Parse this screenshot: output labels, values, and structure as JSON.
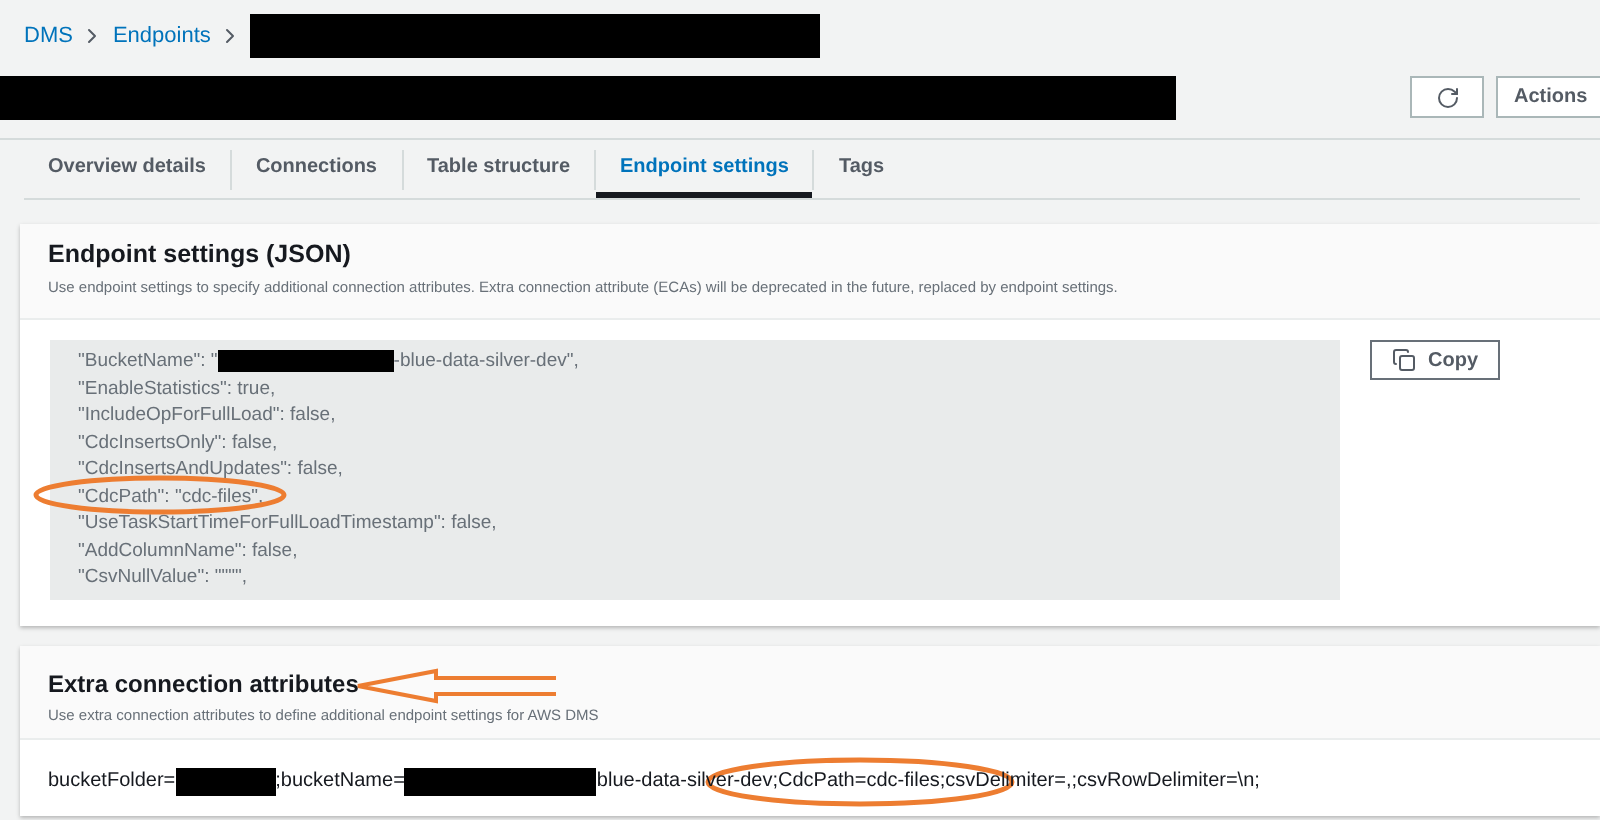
{
  "breadcrumb": [
    {
      "text": "DMS",
      "kind": "link"
    },
    {
      "text": "Endpoints",
      "kind": "link"
    },
    {
      "kind": "redaction"
    }
  ],
  "header": {
    "title": {
      "kind": "redaction"
    },
    "actions": [
      {
        "kind": "refresh"
      },
      {
        "kind": "menu",
        "label": "Actions"
      }
    ]
  },
  "tabs": [
    {
      "label": "Overview details",
      "selected": false
    },
    {
      "label": "Connections",
      "selected": false
    },
    {
      "label": "Table structure",
      "selected": false
    },
    {
      "label": "Endpoint settings",
      "selected": true
    },
    {
      "label": "Tags",
      "selected": false
    }
  ],
  "endpoint_settings": {
    "title": "Endpoint settings (JSON)",
    "description": "Use endpoint settings to specify additional connection attributes. Extra connection attribute (ECAs) will be deprecated in the future, replaced by endpoint settings.",
    "lines": [
      [
        {
          "kind": "text",
          "text": "\"BucketName\": \""
        },
        {
          "kind": "redaction"
        },
        {
          "kind": "text",
          "text": "-blue-data-silver-dev\","
        }
      ],
      [
        {
          "kind": "text",
          "text": "\"EnableStatistics\": true,"
        }
      ],
      [
        {
          "kind": "text",
          "text": "\"IncludeOpForFullLoad\": false,"
        }
      ],
      [
        {
          "kind": "text",
          "text": "\"CdcInsertsOnly\": false,"
        }
      ],
      [
        {
          "kind": "text",
          "text": "\"CdcInsertsAndUpdates\": false,"
        }
      ],
      [
        {
          "kind": "text",
          "text": "\"CdcPath\": \"cdc-files\","
        }
      ],
      [
        {
          "kind": "text",
          "text": "\"UseTaskStartTimeForFullLoadTimestamp\": false,"
        }
      ],
      [
        {
          "kind": "text",
          "text": "\"AddColumnName\": false,"
        }
      ],
      [
        {
          "kind": "text",
          "text": "\"CsvNullValue\": \"\"\"\","
        }
      ]
    ],
    "copy_label": "Copy"
  },
  "extra_connection_attributes": {
    "title": "Extra connection attributes",
    "description": "Use extra connection attributes to define additional endpoint settings for AWS DMS",
    "value": [
      {
        "kind": "text",
        "text": "bucketFolder="
      },
      {
        "kind": "redaction"
      },
      {
        "kind": "text",
        "text": ";bucketName="
      },
      {
        "kind": "redaction"
      },
      {
        "kind": "text",
        "text": "blue-data-silver-dev;CdcPath=cdc-files;csvDelimiter=,;csvRowDelimiter=\\n;"
      }
    ]
  },
  "annotations": [
    {
      "kind": "ellipse"
    },
    {
      "kind": "arrow"
    },
    {
      "kind": "ellipse"
    }
  ]
}
